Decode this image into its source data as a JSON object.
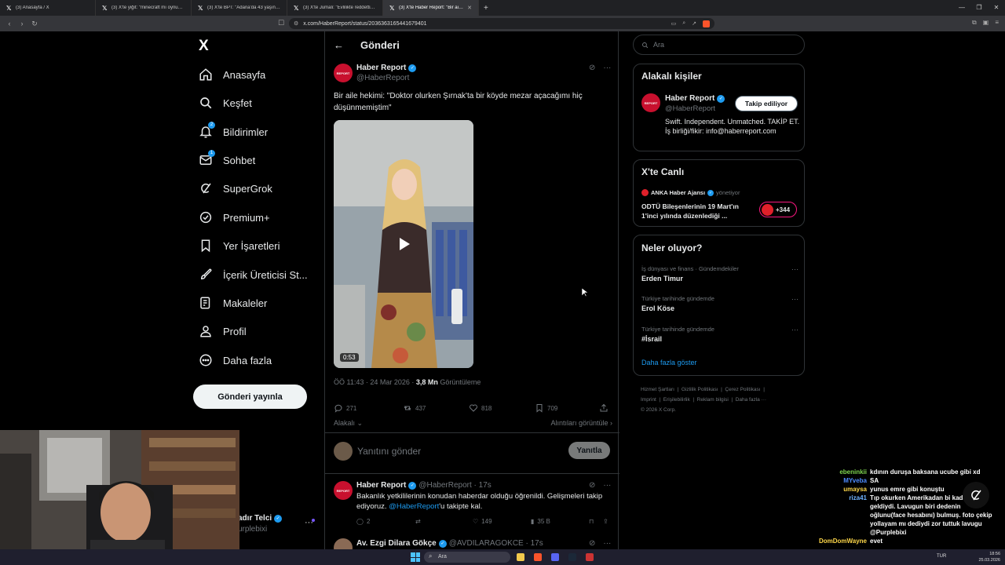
{
  "browser": {
    "tabs": [
      {
        "label": "(3) Anasayfa / X",
        "active": false
      },
      {
        "label": "(3) X'te yiğit: \"minecraft mı oynuyon",
        "active": false
      },
      {
        "label": "(3) X'te BPT: \"Adana'da 43 yaşındaki",
        "active": false
      },
      {
        "label": "(3) X'te Jumali: \"Evlilikte reddettiği zo",
        "active": false
      },
      {
        "label": "(3) X'te Haber Report: \"Bir aile h",
        "active": true
      }
    ],
    "url": "x.com/HaberReport/status/2036363165441679401"
  },
  "nav": {
    "logo": "X",
    "items": [
      {
        "label": "Anasayfa",
        "icon": "home-icon"
      },
      {
        "label": "Keşfet",
        "icon": "search-icon"
      },
      {
        "label": "Bildirimler",
        "icon": "bell-icon",
        "badge": "2"
      },
      {
        "label": "Sohbet",
        "icon": "mail-icon",
        "badge": "1"
      },
      {
        "label": "SuperGrok",
        "icon": "grok-icon"
      },
      {
        "label": "Premium+",
        "icon": "premium-icon"
      },
      {
        "label": "Yer İşaretleri",
        "icon": "bookmark-icon"
      },
      {
        "label": "İçerik Üreticisi St...",
        "icon": "rocket-icon"
      },
      {
        "label": "Makaleler",
        "icon": "article-icon"
      },
      {
        "label": "Profil",
        "icon": "person-icon"
      },
      {
        "label": "Daha fazla",
        "icon": "more-circle-icon"
      }
    ],
    "post_button": "Gönderi yayınla",
    "account": {
      "name": "adır Telci",
      "handle": "urplebixi"
    }
  },
  "header": {
    "back": "←",
    "title": "Gönderi"
  },
  "post": {
    "avatar_text": "REPORT",
    "name": "Haber Report",
    "handle": "@HaberReport",
    "text": "Bir aile hekimi: \"Doktor olurken Şırnak'ta bir köyde mezar açacağımı hiç düşünmemiştim\"",
    "video_duration": "0:53",
    "time": "ÖÖ 11:43 · 24 Mar 2026 · ",
    "views": "3,8 Mn",
    "views_label": " Görüntüleme",
    "replies": "271",
    "reposts": "437",
    "likes": "818",
    "bookmarks": "709",
    "sort_label": "Alakalı",
    "quotes_label": "Alıntıları görüntüle",
    "reply_placeholder": "Yanıtını gönder",
    "reply_button": "Yanıtla"
  },
  "reply1": {
    "name": "Haber Report",
    "handle": "@HaberReport · 17s",
    "text": "Bakanlık yetkililerinin konudan haberdar olduğu öğrenildi. Gelişmeleri takip ediyoruz. ",
    "link": "@HaberReport",
    "text_end": "'u takipte kal.",
    "replies": "2",
    "likes": "149",
    "views": "35 B"
  },
  "reply2": {
    "name": "Av. Ezgi Dilara Gökçe",
    "handle": "@AVDILARAGOKCE · 17s"
  },
  "sidebar": {
    "search_placeholder": "Ara",
    "related_title": "Alakalı kişiler",
    "related": {
      "name": "Haber Report",
      "handle": "@HaberReport",
      "button": "Takip ediliyor",
      "bio": "Swift. Independent. Unmatched. TAKİP ET. İş birliği/fikir: info@haberreport.com"
    },
    "live_title": "X'te Canlı",
    "live": {
      "host": "ANKA Haber Ajansı",
      "role": "yönetiyor",
      "title": "ODTÜ Bileşenlerinin 19 Mart'ın 1'inci yılında düzenlediği ...",
      "count": "+344"
    },
    "trends_title": "Neler oluyor?",
    "trends": [
      {
        "context": "İş dünyası ve finans · Gündemdekiler",
        "topic": "Erden Timur"
      },
      {
        "context": "Türkiye tarihinde gündemde",
        "topic": "Erol Köse"
      },
      {
        "context": "Türkiye tarihinde gündemde",
        "topic": "#İsrail"
      }
    ],
    "show_more": "Daha fazla göster",
    "footer": [
      "Hizmet Şartları",
      "Gizlilik Politikası",
      "Çerez Politikası",
      "Imprint",
      "Erişilebilirlik",
      "Reklam bilgisi",
      "Daha fazla ···",
      "© 2026 X Corp."
    ]
  },
  "chat": [
    {
      "user": "ebeninkii",
      "color": "#7fd64f",
      "msg": "kdının duruşa baksana ucube gibi xd"
    },
    {
      "user": "MYveba",
      "color": "#4f8cff",
      "msg": "SA"
    },
    {
      "user": "umaysa",
      "color": "#ffd84a",
      "msg": "yunus emre gibi konuştu"
    },
    {
      "user": "riza41",
      "color": "#6fb3ff",
      "msg": "Tıp okurken Amerikadan bi kadavra geldiydi. Lavugun biri dedenin oğlunu(face hesabını) bulmuş. foto çekip yollayam mı dediydi zor tuttuk lavugu @Purplebixi"
    },
    {
      "user": "DomDomWayne",
      "color": "#ffd84a",
      "msg": "evet"
    }
  ],
  "taskbar": {
    "search": "Ara",
    "lang": "TUR",
    "time": "18:56",
    "date": "25.03.2026"
  }
}
